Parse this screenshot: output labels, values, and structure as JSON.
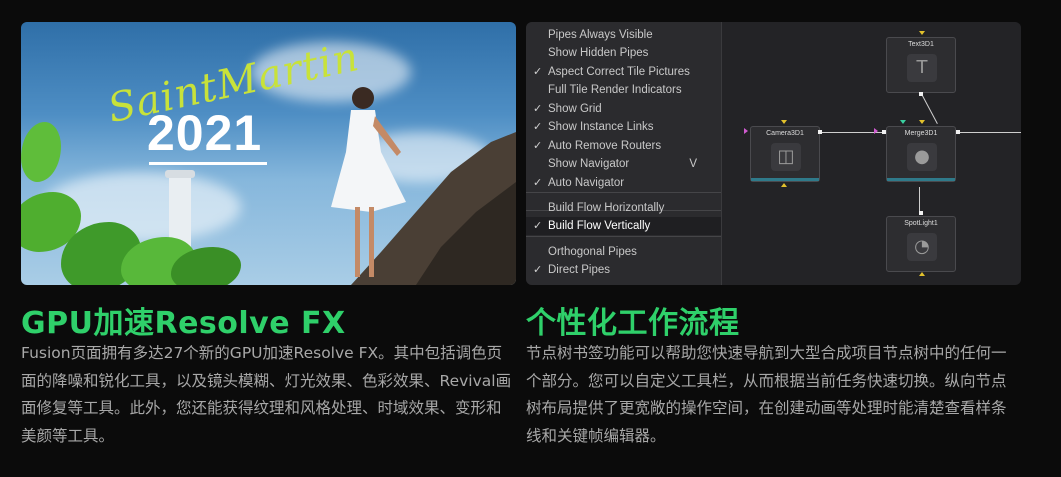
{
  "left": {
    "photo_script": "SaintMartin",
    "photo_year": "2021",
    "heading": "GPU加速Resolve FX",
    "description": "Fusion页面拥有多达27个新的GPU加速Resolve FX。其中包括调色页面的降噪和锐化工具，以及镜头模糊、灯光效果、色彩效果、Revival画面修复等工具。此外，您还能获得纹理和风格处理、时域效果、变形和美颜等工具。"
  },
  "right": {
    "heading": "个性化工作流程",
    "description": "节点树书签功能可以帮助您快速导航到大型合成项目节点树中的任何一个部分。您可以自定义工具栏，从而根据当前任务快速切换。纵向节点树布局提供了更宽敞的操作空间，在创建动画等处理时能清楚查看样条线和关键帧编辑器。",
    "menu": {
      "items": [
        {
          "label": "Pipes Always Visible",
          "checked": false
        },
        {
          "label": "Show Hidden Pipes",
          "checked": false
        },
        {
          "label": "Aspect Correct Tile Pictures",
          "checked": true
        },
        {
          "label": "Full Tile Render Indicators",
          "checked": false
        },
        {
          "label": "Show Grid",
          "checked": true
        },
        {
          "label": "Show Instance Links",
          "checked": true
        },
        {
          "label": "Auto Remove Routers",
          "checked": true
        },
        {
          "label": "Show Navigator",
          "checked": false,
          "shortcut": "V"
        },
        {
          "label": "Auto Navigator",
          "checked": true
        },
        {
          "label": "Build Flow Horizontally",
          "checked": false
        },
        {
          "label": "Build Flow Vertically",
          "checked": true
        },
        {
          "label": "Orthogonal Pipes",
          "checked": false
        },
        {
          "label": "Direct Pipes",
          "checked": true
        }
      ],
      "check_glyph": "✓"
    },
    "nodes": {
      "text": "Text3D1",
      "camera": "Camera3D1",
      "merge": "Merge3D1",
      "light": "SpotLight1"
    }
  },
  "colors": {
    "heading_green": "#2fd06a",
    "body_bg": "#0b0b0b",
    "text_gray": "#a8a8a8"
  }
}
